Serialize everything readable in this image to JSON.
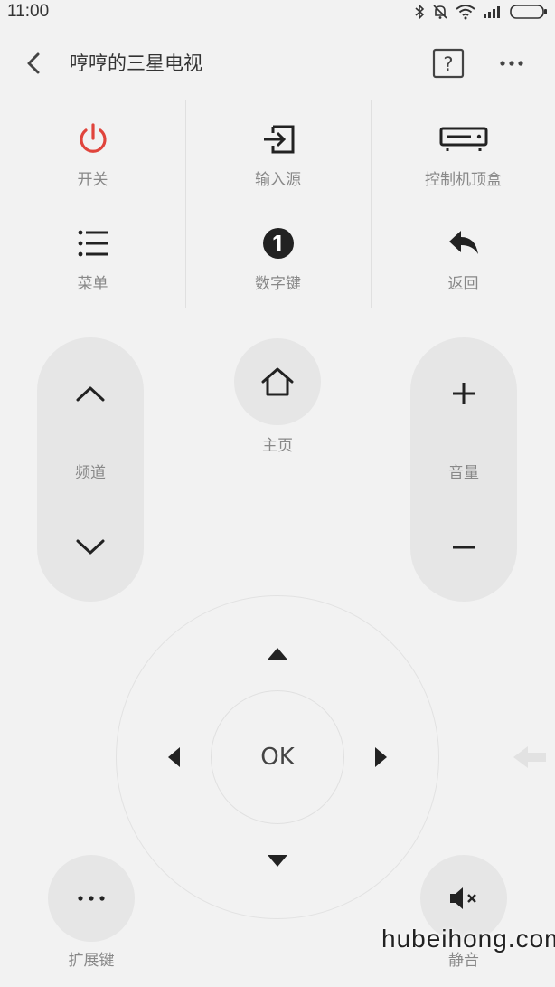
{
  "status_bar": {
    "time": "11:00"
  },
  "header": {
    "title": "哼哼的三星电视"
  },
  "function_grid": [
    {
      "label": "开关",
      "icon": "power-icon",
      "color": "#e0443c"
    },
    {
      "label": "输入源",
      "icon": "input-source-icon"
    },
    {
      "label": "控制机顶盒",
      "icon": "set-top-box-icon"
    },
    {
      "label": "菜单",
      "icon": "menu-list-icon"
    },
    {
      "label": "数字键",
      "icon": "number-keys-icon"
    },
    {
      "label": "返回",
      "icon": "return-icon"
    }
  ],
  "channel": {
    "label": "频道"
  },
  "home": {
    "label": "主页"
  },
  "volume": {
    "label": "音量"
  },
  "dpad": {
    "ok_label": "OK"
  },
  "extend": {
    "label": "扩展键"
  },
  "mute": {
    "label": "静音"
  },
  "watermark": "hubeihong.com",
  "colors": {
    "background": "#f2f2f2",
    "button_fill": "#e6e6e6",
    "power": "#e0443c",
    "label": "#888888"
  }
}
